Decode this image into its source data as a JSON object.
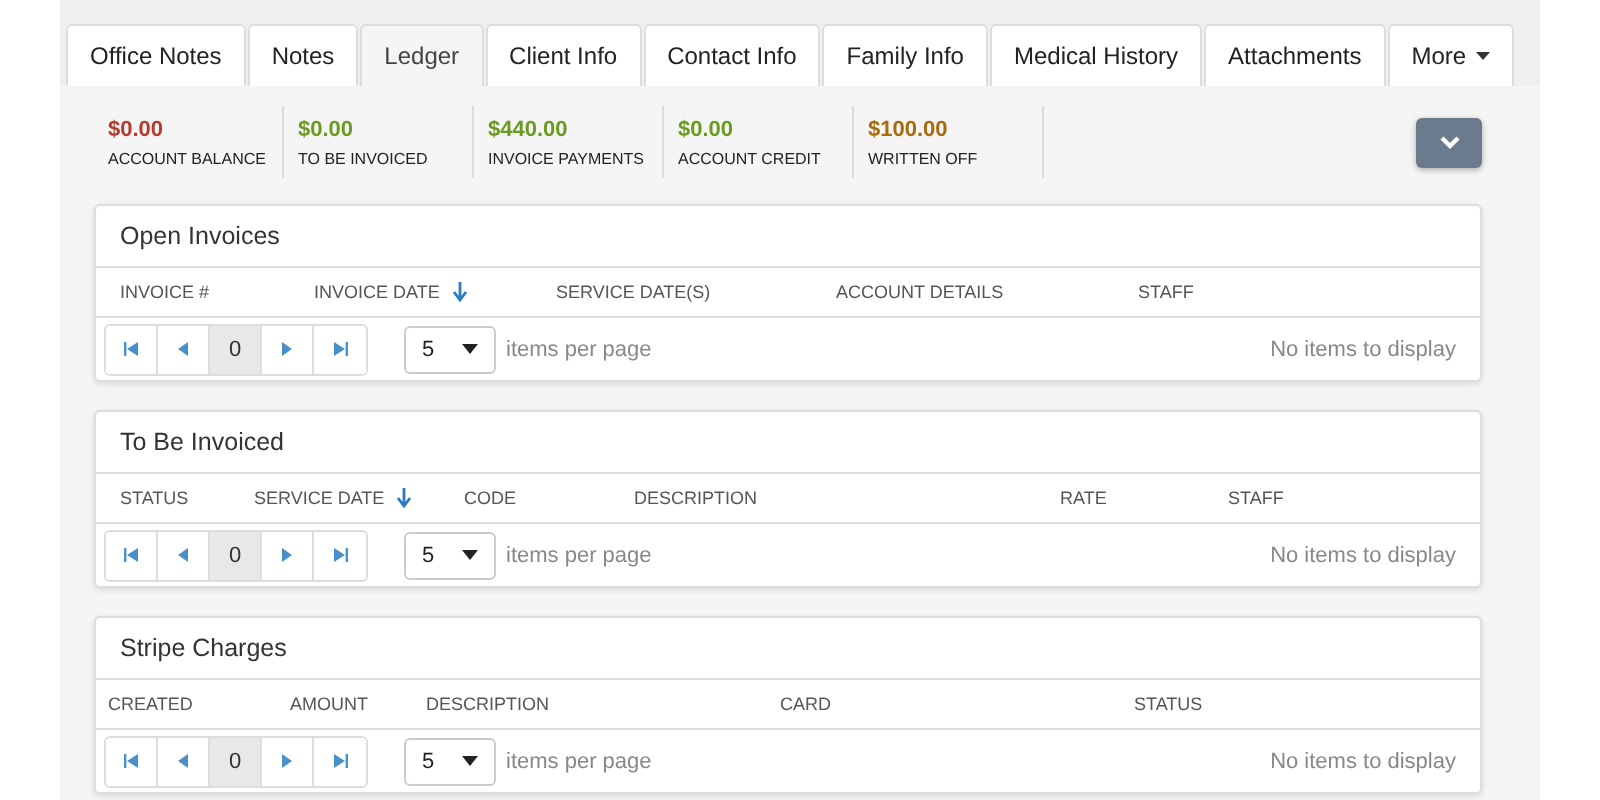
{
  "tabs": [
    {
      "label": "Office Notes",
      "selected": false
    },
    {
      "label": "Notes",
      "selected": false
    },
    {
      "label": "Ledger",
      "selected": true
    },
    {
      "label": "Client Info",
      "selected": false
    },
    {
      "label": "Contact Info",
      "selected": false
    },
    {
      "label": "Family Info",
      "selected": false
    },
    {
      "label": "Medical History",
      "selected": false
    },
    {
      "label": "Attachments",
      "selected": false
    }
  ],
  "more_tab": {
    "label": "More"
  },
  "summary": [
    {
      "value": "$0.00",
      "label": "ACCOUNT BALANCE",
      "color": "#b23a2e"
    },
    {
      "value": "$0.00",
      "label": "TO BE INVOICED",
      "color": "#6a9a1f"
    },
    {
      "value": "$440.00",
      "label": "INVOICE PAYMENTS",
      "color": "#6a9a1f"
    },
    {
      "value": "$0.00",
      "label": "ACCOUNT CREDIT",
      "color": "#6a9a1f"
    },
    {
      "value": "$100.00",
      "label": "WRITTEN OFF",
      "color": "#a86b0c"
    }
  ],
  "panels": [
    {
      "title": "Open Invoices",
      "columns": [
        {
          "label": "INVOICE #",
          "sorted": false
        },
        {
          "label": "INVOICE DATE",
          "sorted": true
        },
        {
          "label": "SERVICE DATE(S)",
          "sorted": false
        },
        {
          "label": "ACCOUNT DETAILS",
          "sorted": false
        },
        {
          "label": "STAFF",
          "sorted": false
        }
      ],
      "page": "0",
      "page_size": "5",
      "page_size_label": "items per page",
      "empty_text": "No items to display"
    },
    {
      "title": "To Be Invoiced",
      "columns": [
        {
          "label": "STATUS",
          "sorted": false
        },
        {
          "label": "SERVICE DATE",
          "sorted": true
        },
        {
          "label": "CODE",
          "sorted": false
        },
        {
          "label": "DESCRIPTION",
          "sorted": false
        },
        {
          "label": "RATE",
          "sorted": false
        },
        {
          "label": "STAFF",
          "sorted": false
        }
      ],
      "page": "0",
      "page_size": "5",
      "page_size_label": "items per page",
      "empty_text": "No items to display"
    },
    {
      "title": "Stripe Charges",
      "columns": [
        {
          "label": "CREATED",
          "sorted": false
        },
        {
          "label": "AMOUNT",
          "sorted": false
        },
        {
          "label": "DESCRIPTION",
          "sorted": false
        },
        {
          "label": "CARD",
          "sorted": false
        },
        {
          "label": "STATUS",
          "sorted": false
        }
      ],
      "page": "0",
      "page_size": "5",
      "page_size_label": "items per page",
      "empty_text": "No items to display"
    }
  ]
}
